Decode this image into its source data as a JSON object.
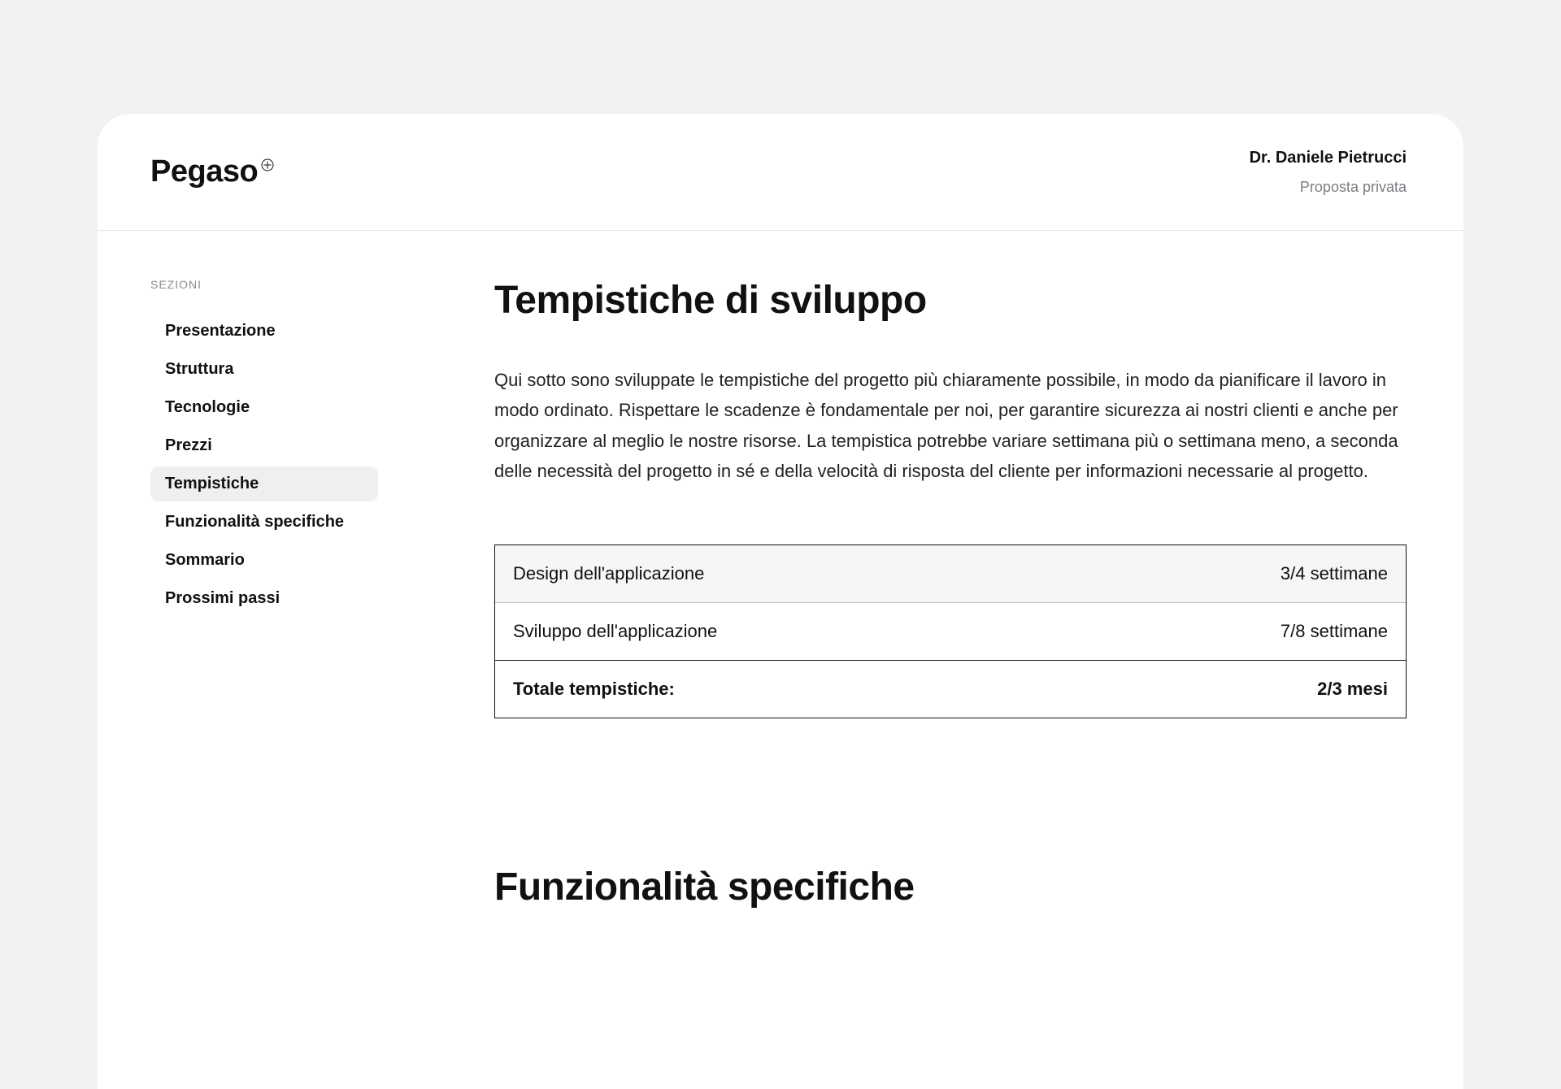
{
  "header": {
    "logo_text": "Pegaso",
    "client_name": "Dr. Daniele Pietrucci",
    "client_subtitle": "Proposta privata"
  },
  "sidebar": {
    "label": "SEZIONI",
    "items": [
      {
        "label": "Presentazione",
        "active": false
      },
      {
        "label": "Struttura",
        "active": false
      },
      {
        "label": "Tecnologie",
        "active": false
      },
      {
        "label": "Prezzi",
        "active": false
      },
      {
        "label": "Tempistiche",
        "active": true
      },
      {
        "label": "Funzionalità specifiche",
        "active": false
      },
      {
        "label": "Sommario",
        "active": false
      },
      {
        "label": "Prossimi passi",
        "active": false
      }
    ]
  },
  "content": {
    "title": "Tempistiche di sviluppo",
    "paragraph": "Qui sotto sono sviluppate le tempistiche del progetto più chiaramente possibile, in modo da pianificare il lavoro in modo ordinato. Rispettare le scadenze è fondamentale per noi, per garantire sicurezza ai nostri clienti e anche per organizzare al meglio le nostre risorse. La tempistica potrebbe variare settimana più o settimana meno, a seconda delle necessità del progetto in sé e della velocità di risposta del cliente per informazioni necessarie al progetto.",
    "timeline": {
      "rows": [
        {
          "label": "Design dell'applicazione",
          "value": "3/4 settimane",
          "type": "header"
        },
        {
          "label": "Sviluppo dell'applicazione",
          "value": "7/8 settimane",
          "type": "normal"
        },
        {
          "label": "Totale tempistiche:",
          "value": "2/3 mesi",
          "type": "total"
        }
      ]
    },
    "next_section_title": "Funzionalità specifiche"
  }
}
